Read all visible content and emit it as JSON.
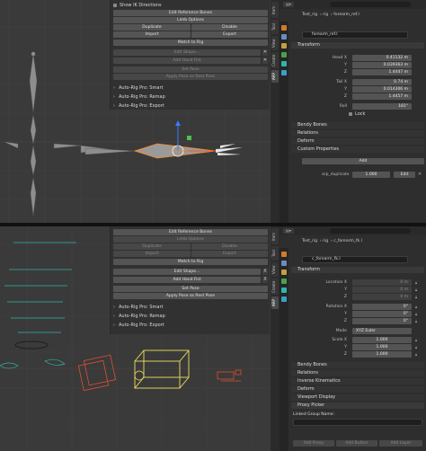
{
  "top_panel": {
    "show_ik_label": "Show IK Directions",
    "edit_ref_label": "Edit Reference Bones",
    "limb_options_label": "Limb Options",
    "duplicate_label": "Duplicate",
    "disable_label": "Disable",
    "import_label": "Import",
    "export_label": "Export",
    "match_rig_label": "Match to Rig",
    "edit_shape_label": "Edit Shape...",
    "add_hand_fist_label": "Add Hand Fist",
    "set_pose_label": "Set Pose",
    "apply_pose_label": "Apply Pose as Rest Pose",
    "sections": [
      "Auto-Rig Pro: Smart",
      "Auto-Rig Pro: Remap",
      "Auto-Rig Pro: Export"
    ]
  },
  "bottom_panel": {
    "edit_ref_label": "Edit Reference Bones",
    "limb_options_label": "Limb Options",
    "duplicate_label": "Duplicate",
    "disable_label": "Disable",
    "import_label": "Import",
    "export_label": "Export",
    "match_rig_label": "Match to Rig",
    "edit_shape_label": "Edit Shape...",
    "add_hand_fist_label": "Add Hand Fist",
    "set_pose_label": "Set Pose",
    "apply_pose_label": "Apply Pose as Rest Pose",
    "close_x": "X",
    "sections": [
      "Auto-Rig Pro: Smart",
      "Auto-Rig Pro: Remap",
      "Auto-Rig Pro: Export"
    ]
  },
  "side_tabs_top": [
    "Item",
    "Tool",
    "View",
    "Create",
    "ARP"
  ],
  "side_tabs_bottom": [
    "Item",
    "Tool",
    "View",
    "Create",
    "ARP"
  ],
  "props_top": {
    "crumb_obj": "Test_rig",
    "crumb_rig": "rig",
    "crumb_bone": "forearm_ref.l",
    "bone_name": "forearm_ref.l",
    "transform_header": "Transform",
    "head_x_label": "Head X",
    "head_x": "0.41132 m",
    "head_y_label": "Y",
    "head_y": "0.039363 m",
    "head_z_label": "Z",
    "head_z": "1.4447 m",
    "tail_x_label": "Tail X",
    "tail_x": "0.74 m",
    "tail_y_label": "Y",
    "tail_y": "0.014306 m",
    "tail_z_label": "Z",
    "tail_z": "1.4457 m",
    "roll_label": "Roll",
    "roll": "181°",
    "lock_label": "Lock",
    "bendy_label": "Bendy Bones",
    "relations_label": "Relations",
    "deform_label": "Deform",
    "custom_props_label": "Custom Properties",
    "add_label": "Add",
    "prop_name": "arp_duplicate",
    "prop_value": "1.000",
    "edit_label": "Edit"
  },
  "props_bottom": {
    "crumb_obj": "Test_rig",
    "crumb_rig": "rig",
    "crumb_bone": "c_forearm_fk.l",
    "bone_name": "c_forearm_fk.l",
    "transform_header": "Transform",
    "loc_x_label": "Location X",
    "loc_x": "0 m",
    "loc_y_label": "Y",
    "loc_y": "0 m",
    "loc_z_label": "Z",
    "loc_z": "0 m",
    "rot_x_label": "Rotation X",
    "rot_x": "0°",
    "rot_y_label": "Y",
    "rot_y": "0°",
    "rot_z_label": "Z",
    "rot_z": "0°",
    "mode_label": "Mode",
    "mode": "XYZ Euler",
    "scale_x_label": "Scale X",
    "scale_x": "1.000",
    "scale_y_label": "Y",
    "scale_y": "1.000",
    "scale_z_label": "Z",
    "scale_z": "1.000",
    "bendy_label": "Bendy Bones",
    "relations_label": "Relations",
    "ik_label": "Inverse Kinematics",
    "deform_label": "Deform",
    "viewport_display_label": "Viewport Display",
    "proxy_picker_label": "Proxy Picker",
    "linked_group_label": "Linked Group Name:",
    "add_proxy_label": "Add Proxy",
    "add_button_label": "Add Button",
    "add_layer_label": "Add Layer"
  },
  "colors": {
    "accent_orange": "#ff8a1e",
    "gizmo_blue": "#3b7bff",
    "gizmo_green": "#4cc04c",
    "active_red": "#e05030",
    "teal": "#2fb6a8"
  }
}
